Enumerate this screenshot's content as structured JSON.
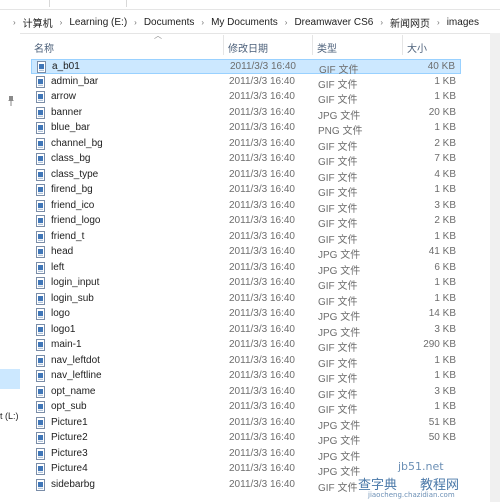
{
  "breadcrumb": [
    "计算机",
    "Learning (E:)",
    "Documents",
    "My Documents",
    "Dreamwaver CS6",
    "新闻网页",
    "images"
  ],
  "header": {
    "name": "名称",
    "date": "修改日期",
    "type": "类型",
    "size": "大小"
  },
  "nav": {
    "drive_label": "t (L:)"
  },
  "files": [
    {
      "name": "a_b01",
      "date": "2011/3/3 16:40",
      "type": "GIF 文件",
      "size": "40 KB",
      "selected": true
    },
    {
      "name": "admin_bar",
      "date": "2011/3/3 16:40",
      "type": "GIF 文件",
      "size": "1 KB"
    },
    {
      "name": "arrow",
      "date": "2011/3/3 16:40",
      "type": "GIF 文件",
      "size": "1 KB"
    },
    {
      "name": "banner",
      "date": "2011/3/3 16:40",
      "type": "JPG 文件",
      "size": "20 KB"
    },
    {
      "name": "blue_bar",
      "date": "2011/3/3 16:40",
      "type": "PNG 文件",
      "size": "1 KB"
    },
    {
      "name": "channel_bg",
      "date": "2011/3/3 16:40",
      "type": "GIF 文件",
      "size": "2 KB"
    },
    {
      "name": "class_bg",
      "date": "2011/3/3 16:40",
      "type": "GIF 文件",
      "size": "7 KB"
    },
    {
      "name": "class_type",
      "date": "2011/3/3 16:40",
      "type": "GIF 文件",
      "size": "4 KB"
    },
    {
      "name": "firend_bg",
      "date": "2011/3/3 16:40",
      "type": "GIF 文件",
      "size": "1 KB"
    },
    {
      "name": "friend_ico",
      "date": "2011/3/3 16:40",
      "type": "GIF 文件",
      "size": "3 KB"
    },
    {
      "name": "friend_logo",
      "date": "2011/3/3 16:40",
      "type": "GIF 文件",
      "size": "2 KB"
    },
    {
      "name": "friend_t",
      "date": "2011/3/3 16:40",
      "type": "GIF 文件",
      "size": "1 KB"
    },
    {
      "name": "head",
      "date": "2011/3/3 16:40",
      "type": "JPG 文件",
      "size": "41 KB"
    },
    {
      "name": "left",
      "date": "2011/3/3 16:40",
      "type": "JPG 文件",
      "size": "6 KB"
    },
    {
      "name": "login_input",
      "date": "2011/3/3 16:40",
      "type": "GIF 文件",
      "size": "1 KB"
    },
    {
      "name": "login_sub",
      "date": "2011/3/3 16:40",
      "type": "GIF 文件",
      "size": "1 KB"
    },
    {
      "name": "logo",
      "date": "2011/3/3 16:40",
      "type": "JPG 文件",
      "size": "14 KB"
    },
    {
      "name": "logo1",
      "date": "2011/3/3 16:40",
      "type": "JPG 文件",
      "size": "3 KB"
    },
    {
      "name": "main-1",
      "date": "2011/3/3 16:40",
      "type": "GIF 文件",
      "size": "290 KB"
    },
    {
      "name": "nav_leftdot",
      "date": "2011/3/3 16:40",
      "type": "GIF 文件",
      "size": "1 KB"
    },
    {
      "name": "nav_leftline",
      "date": "2011/3/3 16:40",
      "type": "GIF 文件",
      "size": "1 KB"
    },
    {
      "name": "opt_name",
      "date": "2011/3/3 16:40",
      "type": "GIF 文件",
      "size": "3 KB"
    },
    {
      "name": "opt_sub",
      "date": "2011/3/3 16:40",
      "type": "GIF 文件",
      "size": "1 KB"
    },
    {
      "name": "Picture1",
      "date": "2011/3/3 16:40",
      "type": "JPG 文件",
      "size": "51 KB"
    },
    {
      "name": "Picture2",
      "date": "2011/3/3 16:40",
      "type": "JPG 文件",
      "size": "50 KB"
    },
    {
      "name": "Picture3",
      "date": "2011/3/3 16:40",
      "type": "JPG 文件",
      "size": ""
    },
    {
      "name": "Picture4",
      "date": "2011/3/3 16:40",
      "type": "JPG 文件",
      "size": ""
    },
    {
      "name": "sidebarbg",
      "date": "2011/3/3 16:40",
      "type": "GIF 文件",
      "size": ""
    }
  ],
  "watermark": {
    "line1": "查字典",
    "line2": "教程网",
    "site": "jiaocheng.chazidian.com",
    "domain": "jb51.net"
  },
  "colors": {
    "selection": "#cce8ff",
    "selection_border": "#99d1ff",
    "header_text": "#4c607a",
    "muted_text": "#6d6d6d"
  },
  "icons": {
    "file": "image-file-icon",
    "pin": "pin-icon",
    "separator": "chevron-right-icon"
  }
}
